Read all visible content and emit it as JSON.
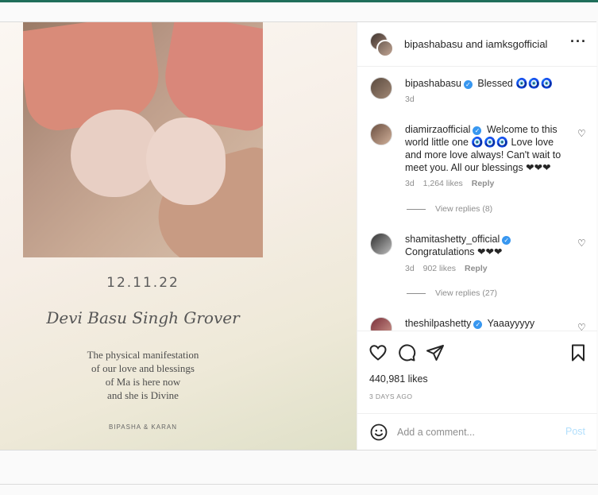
{
  "header": {
    "title": "bipashabasu and iamksgofficial",
    "more_icon": "more-horizontal-icon"
  },
  "card": {
    "date": "12.11.22",
    "name": "Devi Basu Singh Grover",
    "message": "The physical manifestation\nof our love and blessings\nof Ma is here now\nand she is Divine",
    "signature": "BIPASHA & KARAN"
  },
  "caption": {
    "user": "bipashabasu",
    "text": "Blessed 🧿🧿🧿",
    "time": "3d"
  },
  "comments": [
    {
      "user": "diamirzaofficial",
      "text": "Welcome to this world little one 🧿🧿🧿 Love love and more love always! Can't wait to meet you. All our blessings ❤❤❤",
      "time": "3d",
      "likes": "1,264 likes",
      "reply": "Reply",
      "view_replies": "View replies (8)"
    },
    {
      "user": "shamitashetty_official",
      "text": "Congratulations ❤❤❤",
      "time": "3d",
      "likes": "902 likes",
      "reply": "Reply",
      "view_replies": "View replies (27)"
    },
    {
      "user": "theshilpashetty",
      "text": "Yaaayyyyy"
    }
  ],
  "actions": {
    "likes": "440,981 likes",
    "time_ago": "3 DAYS AGO"
  },
  "add_comment": {
    "placeholder": "Add a comment...",
    "post_label": "Post"
  },
  "colors": {
    "verified": "#3897f0",
    "post_button": "#b2dffc",
    "muted": "#8e8e8e"
  }
}
